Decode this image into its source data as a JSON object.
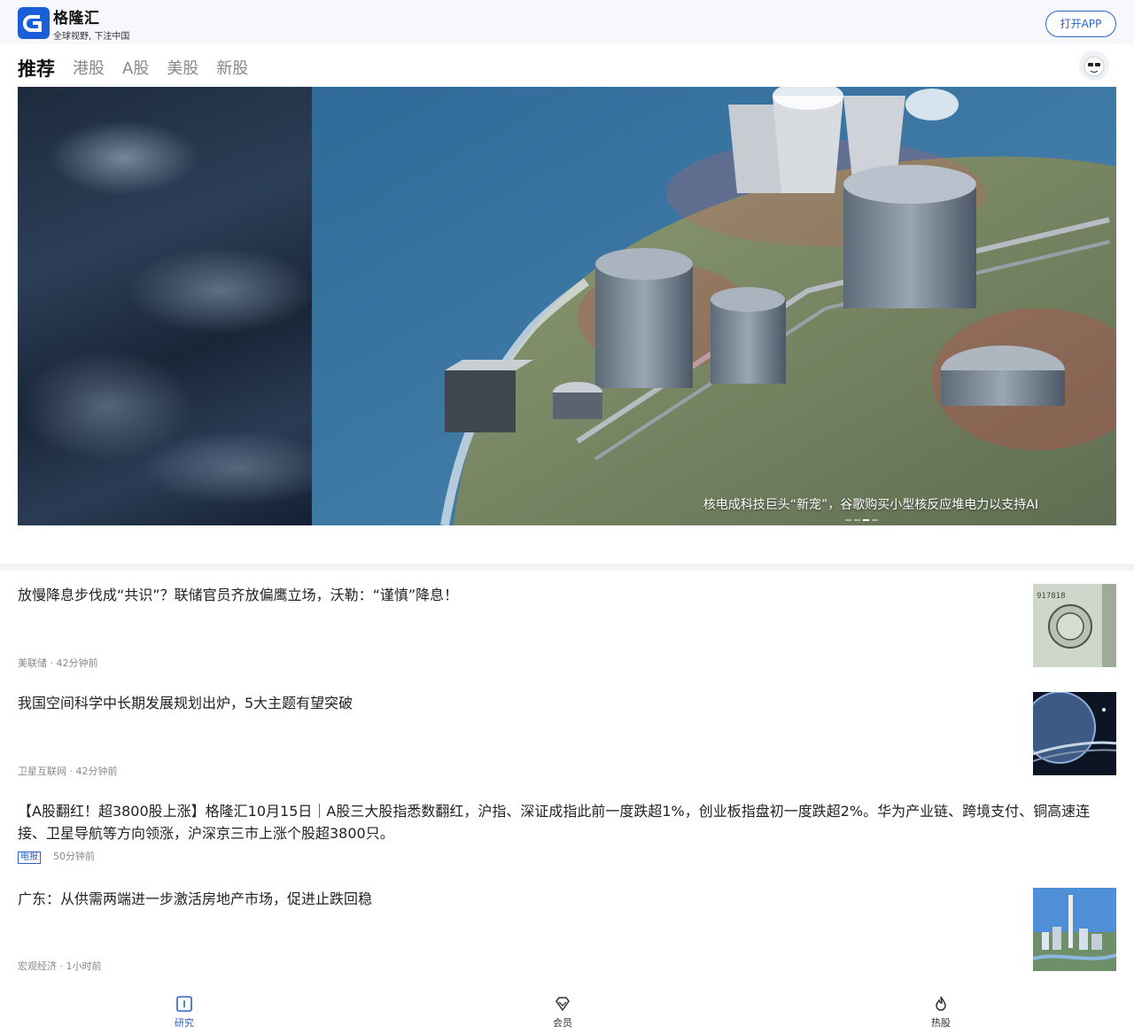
{
  "header": {
    "app_name": "格隆汇",
    "slogan": "全球视野, 下注中国",
    "open_app_label": "打开APP",
    "brand_color": "#1b5fd8"
  },
  "tabs": [
    {
      "label": "推荐",
      "active": true
    },
    {
      "label": "港股",
      "active": false
    },
    {
      "label": "A股",
      "active": false
    },
    {
      "label": "美股",
      "active": false
    },
    {
      "label": "新股",
      "active": false
    }
  ],
  "banner": {
    "caption": "核电成科技巨头“新宠”，谷歌购买小型核反应堆电力以支持AI",
    "slide_count": 4,
    "active_slide": 3
  },
  "news": [
    {
      "title": "放慢降息步伐成“共识”？联储官员齐放偏鹰立场，沃勒：“谨慎”降息！",
      "source": "美联储",
      "time": "42分钟前",
      "thumbnail_icon": "dollar-bill-thumbnail"
    },
    {
      "title": "我国空间科学中长期发展规划出炉，5大主题有望突破",
      "source": "卫星互联网",
      "time": "42分钟前",
      "thumbnail_icon": "planet-thumbnail"
    },
    {
      "title": "【A股翻红！超3800股上涨】格隆汇10月15日｜A股三大股指悉数翻红，沪指、深证成指此前一度跌超1%，创业板指盘初一度跌超2%。华为产业链、跨境支付、铜高速连接、卫星导航等方向领涨，沪深京三市上涨个股超3800只。",
      "tag": "电报",
      "time": "50分钟前"
    },
    {
      "title": "广东：从供需两端进一步激活房地产市场，促进止跌回稳",
      "source": "宏观经济",
      "time": "1小时前",
      "thumbnail_icon": "city-skyline-thumbnail"
    }
  ],
  "bottom_nav": [
    {
      "label": "研究",
      "icon": "book-icon",
      "active": true
    },
    {
      "label": "会员",
      "icon": "diamond-icon",
      "active": false
    },
    {
      "label": "热股",
      "icon": "flame-icon",
      "active": false
    }
  ],
  "colors": {
    "accent": "#2b63c9",
    "meta_text": "#888888"
  }
}
